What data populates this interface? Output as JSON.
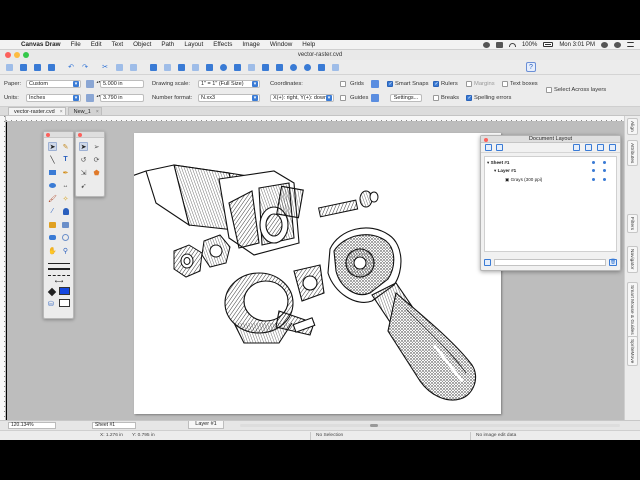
{
  "menubar": {
    "app_name": "Canvas Draw",
    "items": [
      "File",
      "Edit",
      "Text",
      "Object",
      "Path",
      "Layout",
      "Effects",
      "Image",
      "Window",
      "Help"
    ],
    "battery": "100%",
    "clock": "Mon 3:01 PM"
  },
  "window": {
    "title": "vector-raster.cvd"
  },
  "props": {
    "paper_label": "Paper:",
    "paper_value": "Custom",
    "units_label": "Units:",
    "units_value": "Inches",
    "width_value": "5.000 in",
    "height_value": "3.790 in",
    "drawing_scale_label": "Drawing scale:",
    "drawing_scale_value": "1\" = 1\"  (Full Size)",
    "number_format_label": "Number format:",
    "number_format_value": "N.xx3",
    "coordinates_label": "Coordinates:",
    "coordinates_value": "X(+): right, Y(+): down",
    "grids_label": "Grids",
    "guides_label": "Guides",
    "smart_snaps_label": "Smart Snaps",
    "settings_label": "Settings...",
    "rulers_label": "Rulers",
    "margins_label": "Margins",
    "breaks_label": "Breaks",
    "text_boxes_label": "Text boxes",
    "spelling_label": "Spelling errors",
    "select_across_label": "Select Across layers"
  },
  "tabs": [
    {
      "label": "vector-raster.cvd"
    },
    {
      "label": "New_1"
    }
  ],
  "side_tabs": [
    "Align",
    "Attributes",
    "Filters",
    "Navigator",
    "Smart Mouse & Guides",
    "SpriteMove"
  ],
  "doc_layout": {
    "title": "Document Layout",
    "sheet": "Sheet #1",
    "layer": "Layer #1",
    "object": "Grays (300 ppi)"
  },
  "bottom": {
    "zoom": "120.134%",
    "sheet": "Sheet #1",
    "layer_tab": "Layer #1"
  },
  "status": {
    "x": "X: 1.276 in",
    "y": "Y: 0.795 in",
    "selection": "No Selection",
    "edit": "No image edit data"
  },
  "colors": {
    "accent": "#3a7bd5",
    "canvas_bg": "#bdbdbd",
    "close_red": "#fc605b"
  }
}
